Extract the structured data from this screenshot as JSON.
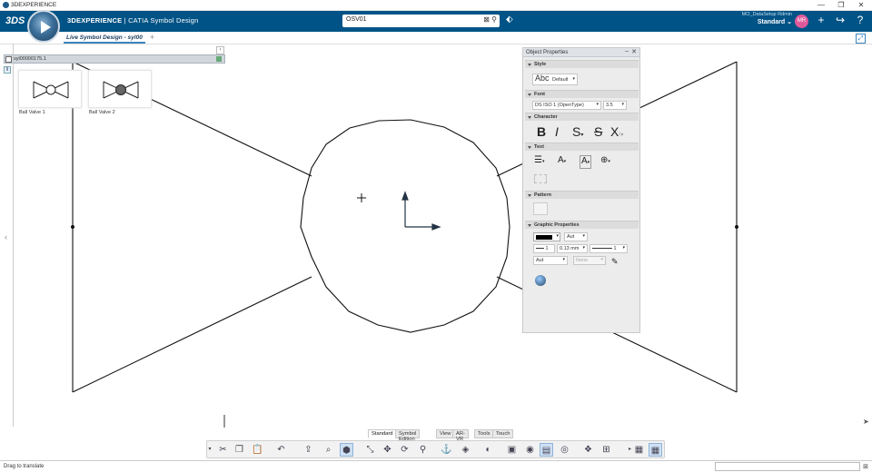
{
  "window": {
    "title": "3DEXPERIENCE",
    "minimize": "—",
    "restore": "❐",
    "close": "✕"
  },
  "header": {
    "brand_bold": "3DEXPERIENCE",
    "brand_sep": " | ",
    "brand_app": "CATIA Symbol Design",
    "search_value": "OSV01",
    "user_workspace": "MO_DataSetup  Rdmin",
    "user_role": "Standard ⌄",
    "avatar_initials": "MR",
    "ds_logo": "3DS"
  },
  "tabs": {
    "active_tab": "Live Symbol Design - syl00",
    "add_tab": "+"
  },
  "tree": {
    "root_label": "syl00000175.1"
  },
  "palette": {
    "items": [
      {
        "label": "Ball Valve 1"
      },
      {
        "label": "Ball Valve 2"
      }
    ]
  },
  "object_properties": {
    "title": "Object Properties",
    "sections": {
      "style": "Style",
      "font": "Font",
      "character": "Character",
      "text": "Text",
      "pattern": "Pattern",
      "graphic": "Graphic Properties"
    },
    "style_value": "Default",
    "style_glyph": "Abc",
    "font_name": "DS ISO 1 (OpenType)",
    "font_size": "3.5",
    "line_color_value": "Aut",
    "line_weight_num": "1",
    "line_weight_value": "0.13 mm",
    "line_type_num": "1",
    "fill_value": "Aut",
    "fill_none": "None"
  },
  "bottom_tabs": [
    "Standard",
    "Symbol Edition",
    "View",
    "AR-VR",
    "Tools",
    "Touch"
  ],
  "status": {
    "message": "Drag to translate"
  },
  "colors": {
    "header": "#005386",
    "accent": "#3a86c0"
  }
}
